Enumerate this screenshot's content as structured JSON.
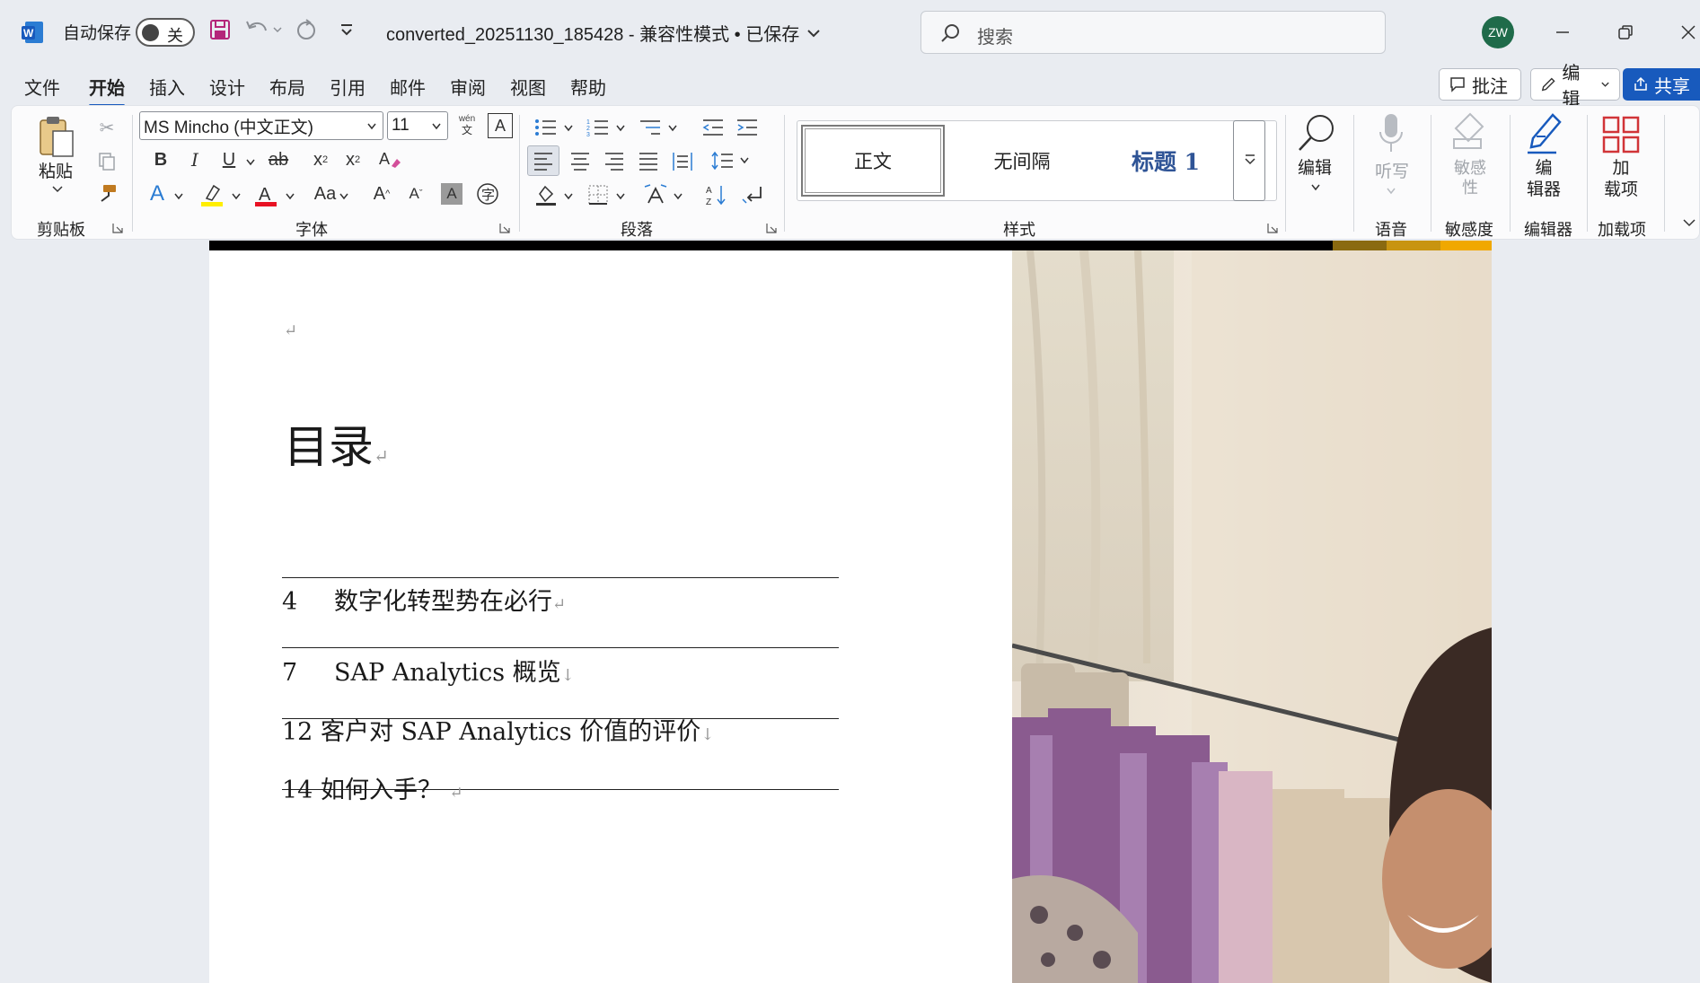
{
  "titlebar": {
    "autosave_label": "自动保存",
    "autosave_state": "关",
    "doc_title": "converted_20251130_185428  -  兼容性模式 • 已保存",
    "search_placeholder": "搜索",
    "avatar_initials": "ZW"
  },
  "menu_tabs": [
    "文件",
    "开始",
    "插入",
    "设计",
    "布局",
    "引用",
    "邮件",
    "审阅",
    "视图",
    "帮助"
  ],
  "active_tab": "开始",
  "right_buttons": {
    "comment": "批注",
    "edit": "编辑",
    "share": "共享"
  },
  "ribbon": {
    "clipboard": {
      "paste": "粘贴",
      "label": "剪贴板"
    },
    "font": {
      "name": "MS Mincho (中文正文)",
      "size": "11",
      "label": "字体"
    },
    "paragraph": {
      "label": "段落"
    },
    "styles": {
      "items": [
        "正文",
        "无间隔",
        "标题 1"
      ],
      "label": "样式"
    },
    "editing": {
      "label": "编辑"
    },
    "voice": {
      "dictate": "听写",
      "label": "语音"
    },
    "sensitivity": {
      "btn": "敏感\n性",
      "label": "敏感度"
    },
    "editor": {
      "btn": "编\n辑器",
      "label": "编辑器"
    },
    "addins": {
      "btn": "加\n载项",
      "label": "加载项"
    }
  },
  "document": {
    "toc_title": "目录",
    "entries": [
      {
        "num": "4",
        "text": "数字化转型势在必行"
      },
      {
        "num": "7",
        "text": "SAP Analytics 概览"
      },
      {
        "num": "12",
        "text": "客户对 SAP Analytics 价值的评价"
      },
      {
        "num": "14",
        "text": "如何入手？"
      }
    ]
  },
  "colors": {
    "accent": "#185abd",
    "ribbon_bg": "#fbfbfc",
    "window_bg": "#e9ecf1"
  }
}
